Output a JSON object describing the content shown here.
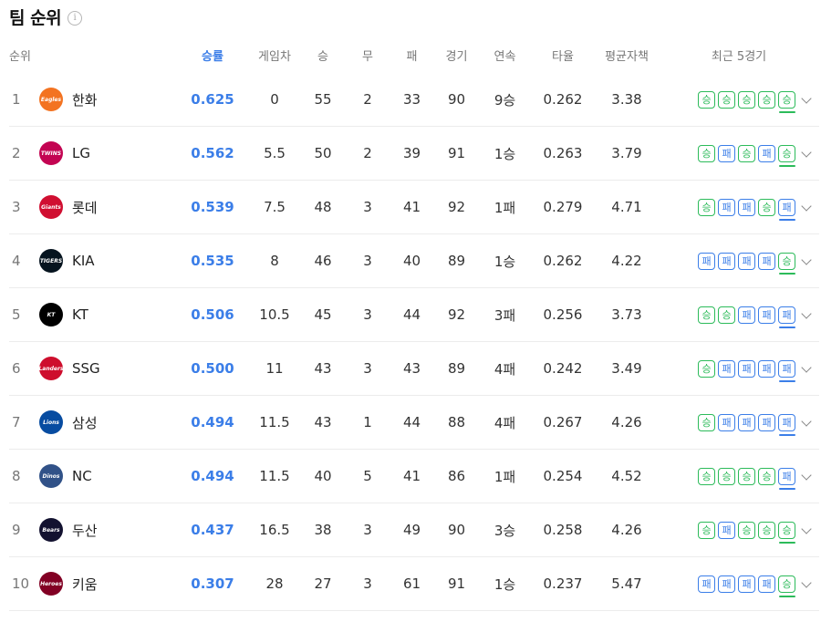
{
  "page": {
    "title": "팀 순위",
    "info_icon": "i"
  },
  "headers": {
    "rank": "순위",
    "pct": "승률",
    "gb": "게임차",
    "w": "승",
    "d": "무",
    "l": "패",
    "g": "경기",
    "streak": "연속",
    "avg": "타율",
    "era": "평균자책",
    "recent": "최근 5경기"
  },
  "colors": {
    "accent": "#3b7ee8",
    "win": "#2cbb5a",
    "loss": "#3b7ee8"
  },
  "teams": [
    {
      "rank": "1",
      "name": "한화",
      "logo": "eagles-logo",
      "pct": "0.625",
      "gb": "0",
      "w": "55",
      "d": "2",
      "l": "33",
      "g": "90",
      "streak": "9승",
      "avg": "0.262",
      "era": "3.38",
      "recent": [
        "승",
        "승",
        "승",
        "승",
        "승"
      ]
    },
    {
      "rank": "2",
      "name": "LG",
      "logo": "twins-logo",
      "pct": "0.562",
      "gb": "5.5",
      "w": "50",
      "d": "2",
      "l": "39",
      "g": "91",
      "streak": "1승",
      "avg": "0.263",
      "era": "3.79",
      "recent": [
        "승",
        "패",
        "승",
        "패",
        "승"
      ]
    },
    {
      "rank": "3",
      "name": "롯데",
      "logo": "giants-logo",
      "pct": "0.539",
      "gb": "7.5",
      "w": "48",
      "d": "3",
      "l": "41",
      "g": "92",
      "streak": "1패",
      "avg": "0.279",
      "era": "4.71",
      "recent": [
        "승",
        "패",
        "패",
        "승",
        "패"
      ]
    },
    {
      "rank": "4",
      "name": "KIA",
      "logo": "tigers-logo",
      "pct": "0.535",
      "gb": "8",
      "w": "46",
      "d": "3",
      "l": "40",
      "g": "89",
      "streak": "1승",
      "avg": "0.262",
      "era": "4.22",
      "recent": [
        "패",
        "패",
        "패",
        "패",
        "승"
      ]
    },
    {
      "rank": "5",
      "name": "KT",
      "logo": "wiz-logo",
      "pct": "0.506",
      "gb": "10.5",
      "w": "45",
      "d": "3",
      "l": "44",
      "g": "92",
      "streak": "3패",
      "avg": "0.256",
      "era": "3.73",
      "recent": [
        "승",
        "승",
        "패",
        "패",
        "패"
      ]
    },
    {
      "rank": "6",
      "name": "SSG",
      "logo": "landers-logo",
      "pct": "0.500",
      "gb": "11",
      "w": "43",
      "d": "3",
      "l": "43",
      "g": "89",
      "streak": "4패",
      "avg": "0.242",
      "era": "3.49",
      "recent": [
        "승",
        "패",
        "패",
        "패",
        "패"
      ]
    },
    {
      "rank": "7",
      "name": "삼성",
      "logo": "lions-logo",
      "pct": "0.494",
      "gb": "11.5",
      "w": "43",
      "d": "1",
      "l": "44",
      "g": "88",
      "streak": "4패",
      "avg": "0.267",
      "era": "4.26",
      "recent": [
        "승",
        "패",
        "패",
        "패",
        "패"
      ]
    },
    {
      "rank": "8",
      "name": "NC",
      "logo": "dinos-logo",
      "pct": "0.494",
      "gb": "11.5",
      "w": "40",
      "d": "5",
      "l": "41",
      "g": "86",
      "streak": "1패",
      "avg": "0.254",
      "era": "4.52",
      "recent": [
        "승",
        "승",
        "승",
        "승",
        "패"
      ]
    },
    {
      "rank": "9",
      "name": "두산",
      "logo": "bears-logo",
      "pct": "0.437",
      "gb": "16.5",
      "w": "38",
      "d": "3",
      "l": "49",
      "g": "90",
      "streak": "3승",
      "avg": "0.258",
      "era": "4.26",
      "recent": [
        "승",
        "패",
        "승",
        "승",
        "승"
      ]
    },
    {
      "rank": "10",
      "name": "키움",
      "logo": "heroes-logo",
      "pct": "0.307",
      "gb": "28",
      "w": "27",
      "d": "3",
      "l": "61",
      "g": "91",
      "streak": "1승",
      "avg": "0.237",
      "era": "5.47",
      "recent": [
        "패",
        "패",
        "패",
        "패",
        "승"
      ]
    }
  ]
}
